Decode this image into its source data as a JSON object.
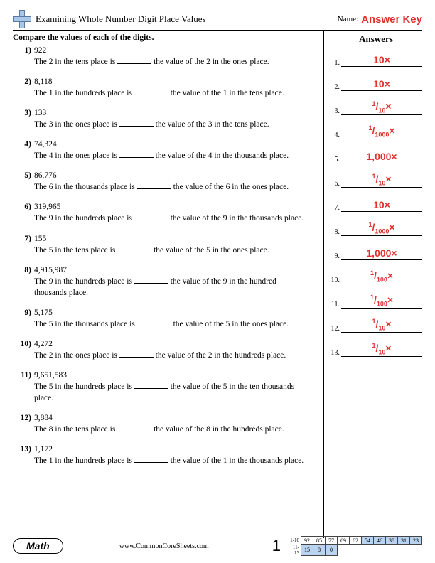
{
  "header": {
    "title": "Examining Whole Number Digit Place Values",
    "name_label": "Name:",
    "answer_key": "Answer Key"
  },
  "instructions": "Compare the values of each of the digits.",
  "answers_heading": "Answers",
  "questions": [
    {
      "n": "1)",
      "num": "922",
      "t": "The 2 in the tens place is ______ the value of the 2 in the ones place."
    },
    {
      "n": "2)",
      "num": "8,118",
      "t": "The 1 in the hundreds place is ______ the value of the 1 in the tens place."
    },
    {
      "n": "3)",
      "num": "133",
      "t": "The 3 in the ones place is ______ the value of the 3 in the tens place."
    },
    {
      "n": "4)",
      "num": "74,324",
      "t": "The 4 in the ones place is ______ the value of the 4 in the thousands place."
    },
    {
      "n": "5)",
      "num": "86,776",
      "t": "The 6 in the thousands place is ______ the value of the 6 in the ones place."
    },
    {
      "n": "6)",
      "num": "319,965",
      "t": "The 9 in the hundreds place is ______ the value of the 9 in the thousands place."
    },
    {
      "n": "7)",
      "num": "155",
      "t": "The 5 in the tens place is ______ the value of the 5 in the ones place."
    },
    {
      "n": "8)",
      "num": "4,915,987",
      "t": "The 9 in the hundreds place is ______ the value of the 9 in the hundred thousands place."
    },
    {
      "n": "9)",
      "num": "5,175",
      "t": "The 5 in the thousands place is ______ the value of the 5 in the ones place."
    },
    {
      "n": "10)",
      "num": "4,272",
      "t": "The 2 in the ones place is ______ the value of the 2 in the hundreds place."
    },
    {
      "n": "11)",
      "num": "9,651,583",
      "t": "The 5 in the hundreds place is ______ the value of the 5 in the ten thousands place."
    },
    {
      "n": "12)",
      "num": "3,884",
      "t": "The 8 in the tens place is ______ the value of the 8 in the hundreds place."
    },
    {
      "n": "13)",
      "num": "1,172",
      "t": "The 1 in the hundreds place is ______ the value of the 1 in the thousands place."
    }
  ],
  "answers": [
    {
      "n": "1.",
      "html": "10×"
    },
    {
      "n": "2.",
      "html": "10×"
    },
    {
      "n": "3.",
      "html": "<span class='fr'>1</span>/<span class='fd'>10</span>×"
    },
    {
      "n": "4.",
      "html": "<span class='fr'>1</span>/<span class='fd'>1000</span>×"
    },
    {
      "n": "5.",
      "html": "1,000×"
    },
    {
      "n": "6.",
      "html": "<span class='fr'>1</span>/<span class='fd'>10</span>×"
    },
    {
      "n": "7.",
      "html": "10×"
    },
    {
      "n": "8.",
      "html": "<span class='fr'>1</span>/<span class='fd'>1000</span>×"
    },
    {
      "n": "9.",
      "html": "1,000×"
    },
    {
      "n": "10.",
      "html": "<span class='fr'>1</span>/<span class='fd'>100</span>×"
    },
    {
      "n": "11.",
      "html": "<span class='fr'>1</span>/<span class='fd'>100</span>×"
    },
    {
      "n": "12.",
      "html": "<span class='fr'>1</span>/<span class='fd'>10</span>×"
    },
    {
      "n": "13.",
      "html": "<span class='fr'>1</span>/<span class='fd'>10</span>×"
    }
  ],
  "footer": {
    "subject": "Math",
    "site": "www.CommonCoreSheets.com",
    "page": "1",
    "grid": {
      "row1_label": "1-10",
      "row1": [
        "92",
        "85",
        "77",
        "69",
        "62",
        "54",
        "46",
        "38",
        "31",
        "23"
      ],
      "row2_label": "11-13",
      "row2": [
        "15",
        "8",
        "0"
      ],
      "hl_start": 5
    }
  }
}
